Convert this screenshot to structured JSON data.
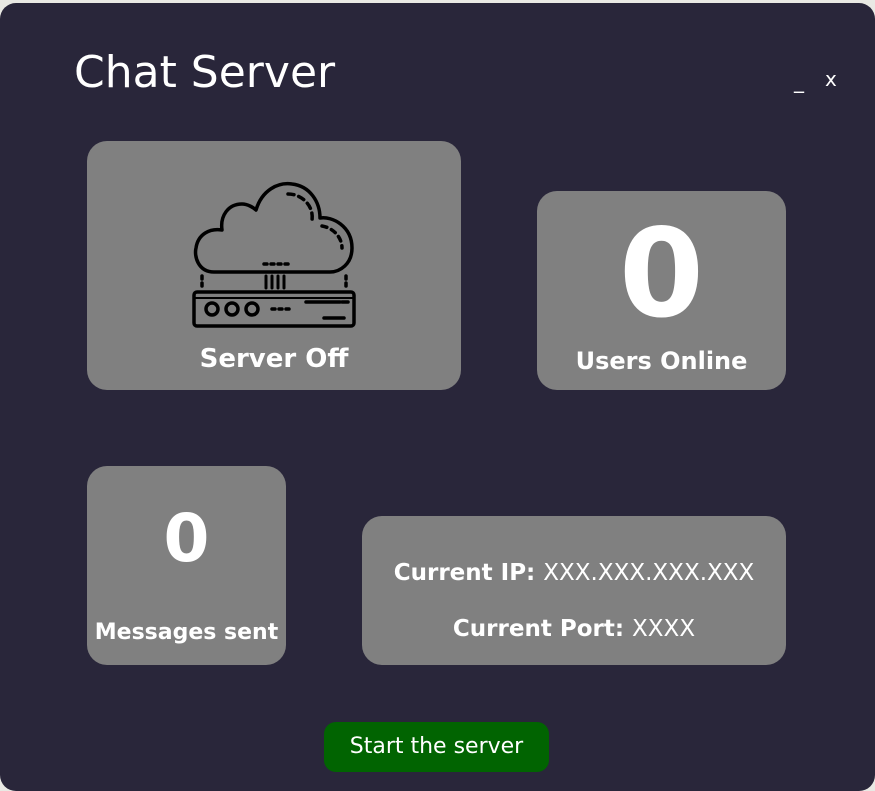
{
  "window": {
    "title": "Chat Server",
    "minimize_label": "_",
    "close_label": "x"
  },
  "status_card": {
    "icon": "cloud-server-icon",
    "label": "Server Off"
  },
  "users_card": {
    "count": "0",
    "label": "Users Online"
  },
  "messages_card": {
    "count": "0",
    "label": "Messages sent"
  },
  "network_card": {
    "ip_label": "Current IP:",
    "ip_value": "XXX.XXX.XXX.XXX",
    "port_label": "Current Port:",
    "port_value": "XXXX"
  },
  "start_button": {
    "label": "Start the server"
  },
  "colors": {
    "window_bg": "#29263a",
    "card_bg": "#808080",
    "button_bg": "#016401",
    "text": "#ffffff"
  }
}
